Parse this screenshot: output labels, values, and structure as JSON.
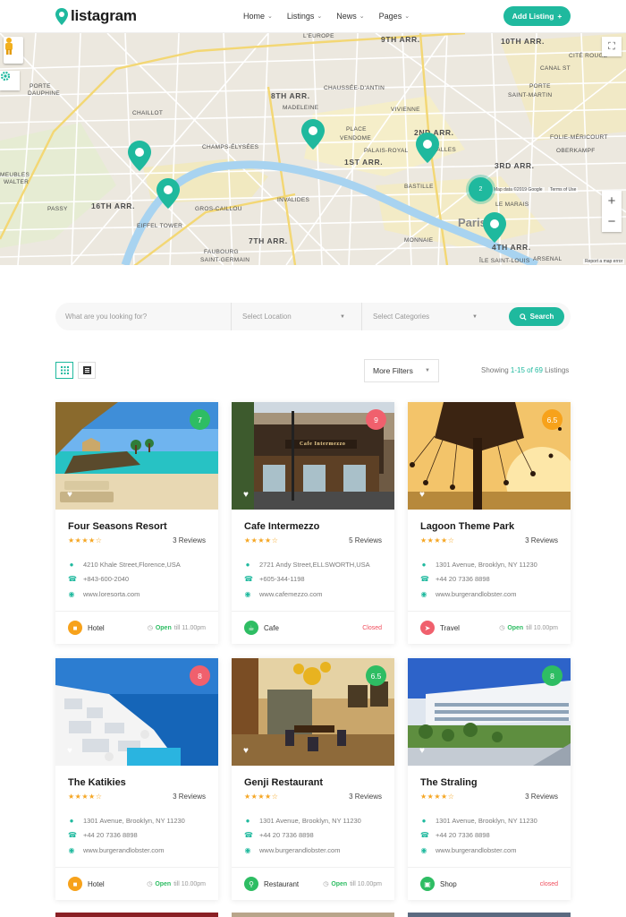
{
  "header": {
    "logo_text": "listagram",
    "nav": [
      {
        "label": "Home"
      },
      {
        "label": "Listings"
      },
      {
        "label": "News"
      },
      {
        "label": "Pages"
      }
    ],
    "add_listing_label": "Add Listing"
  },
  "map": {
    "labels": [
      "L'EUROPE",
      "9TH ARR.",
      "10TH ARR.",
      "CITÉ ROUGE",
      "CANAL ST",
      "PORTE",
      "SAINT-MARTIN",
      "PORTE",
      "DAUPHINE",
      "8TH ARR.",
      "CHAUSSÉE-D'ANTIN",
      "MADELEINE",
      "CHAILLOT",
      "PLACE",
      "VENDOME",
      "VIVIENNE",
      "2ND ARR.",
      "FOLIE-MÉRICOURT",
      "PALAIS-ROYAL",
      "1ST ARR.",
      "LES HALLES",
      "OBERKAMPF",
      "CHAMPS-ÉLYSÉES",
      "3RD ARR.",
      "BASTILLE",
      "16TH ARR.",
      "GROS-CAILLOU",
      "INVALIDES",
      "LE MARAIS",
      "PASSY",
      "EIFFEL TOWER",
      "7TH ARR.",
      "MONNAIE",
      "4TH ARR.",
      "FAUBOURG",
      "SAINT-GERMAIN",
      "ÎLE SAINT-LOUIS",
      "ARSENAL",
      "MEUBLES",
      "WALTER",
      "Paris",
      "Map data ©2019 Google",
      "Terms of Use",
      "Report a map error"
    ],
    "cluster_count": "2"
  },
  "search": {
    "what_placeholder": "What are you looking for?",
    "location_placeholder": "Select Location",
    "categories_placeholder": "Select Categories",
    "button_label": "Search"
  },
  "toolbar": {
    "filters_label": "More Filters",
    "showing_prefix": "Showing ",
    "showing_range": "1-15 of 69",
    "showing_suffix": " Listings"
  },
  "listings": [
    {
      "title": "Four Seasons Resort",
      "rating": "7",
      "badge_color": "#2ebd63",
      "reviews": "3 Reviews",
      "address": "4210 Khale Street,Florence,USA",
      "phone": "+843-600-2040",
      "website": "www.loresorta.com",
      "category": "Hotel",
      "category_color": "#f7a21b",
      "category_icon": "bed-icon",
      "status_open": "Open",
      "status_rest": " till 11.00pm"
    },
    {
      "title": "Cafe Intermezzo",
      "rating": "9",
      "badge_color": "#f0606d",
      "reviews": "5 Reviews",
      "address": "2721 Andy Street,ELLSWORTH,USA",
      "phone": "+605-344-1198",
      "website": "www.cafemezzo.com",
      "category": "Cafe",
      "category_color": "#2ebd63",
      "category_icon": "cup-icon",
      "status_closed": "Closed"
    },
    {
      "title": "Lagoon Theme Park",
      "rating": "6.5",
      "badge_color": "#f7a21b",
      "reviews": "3 Reviews",
      "address": "1301 Avenue, Brooklyn, NY 11230",
      "phone": "+44 20 7336 8898",
      "website": "www.burgerandlobster.com",
      "category": "Travel",
      "category_color": "#f0606d",
      "category_icon": "walk-icon",
      "status_open": "Open",
      "status_rest": " till 10.00pm"
    },
    {
      "title": "The Katikies",
      "rating": "8",
      "badge_color": "#f0606d",
      "reviews": "3 Reviews",
      "address": "1301 Avenue, Brooklyn, NY 11230",
      "phone": "+44 20 7336 8898",
      "website": "www.burgerandlobster.com",
      "category": "Hotel",
      "category_color": "#f7a21b",
      "category_icon": "bed-icon",
      "status_open": "Open",
      "status_rest": " till 10.00pm"
    },
    {
      "title": "Genji Restaurant",
      "rating": "6.5",
      "badge_color": "#2ebd63",
      "reviews": "3 Reviews",
      "address": "1301 Avenue, Brooklyn, NY 11230",
      "phone": "+44 20 7336 8898",
      "website": "www.burgerandlobster.com",
      "category": "Restaurant",
      "category_color": "#2ebd63",
      "category_icon": "utensils-icon",
      "status_open": "Open",
      "status_rest": " till 10.00pm"
    },
    {
      "title": "The Straling",
      "rating": "8",
      "badge_color": "#2ebd63",
      "reviews": "3 Reviews",
      "address": "1301 Avenue, Brooklyn, NY 11230",
      "phone": "+44 20 7336 8898",
      "website": "www.burgerandlobster.com",
      "category": "Shop",
      "category_color": "#2ebd63",
      "category_icon": "bag-icon",
      "status_closed": "closed"
    }
  ],
  "colors": {
    "accent": "#1fb99e",
    "stars": "#f5a623"
  }
}
